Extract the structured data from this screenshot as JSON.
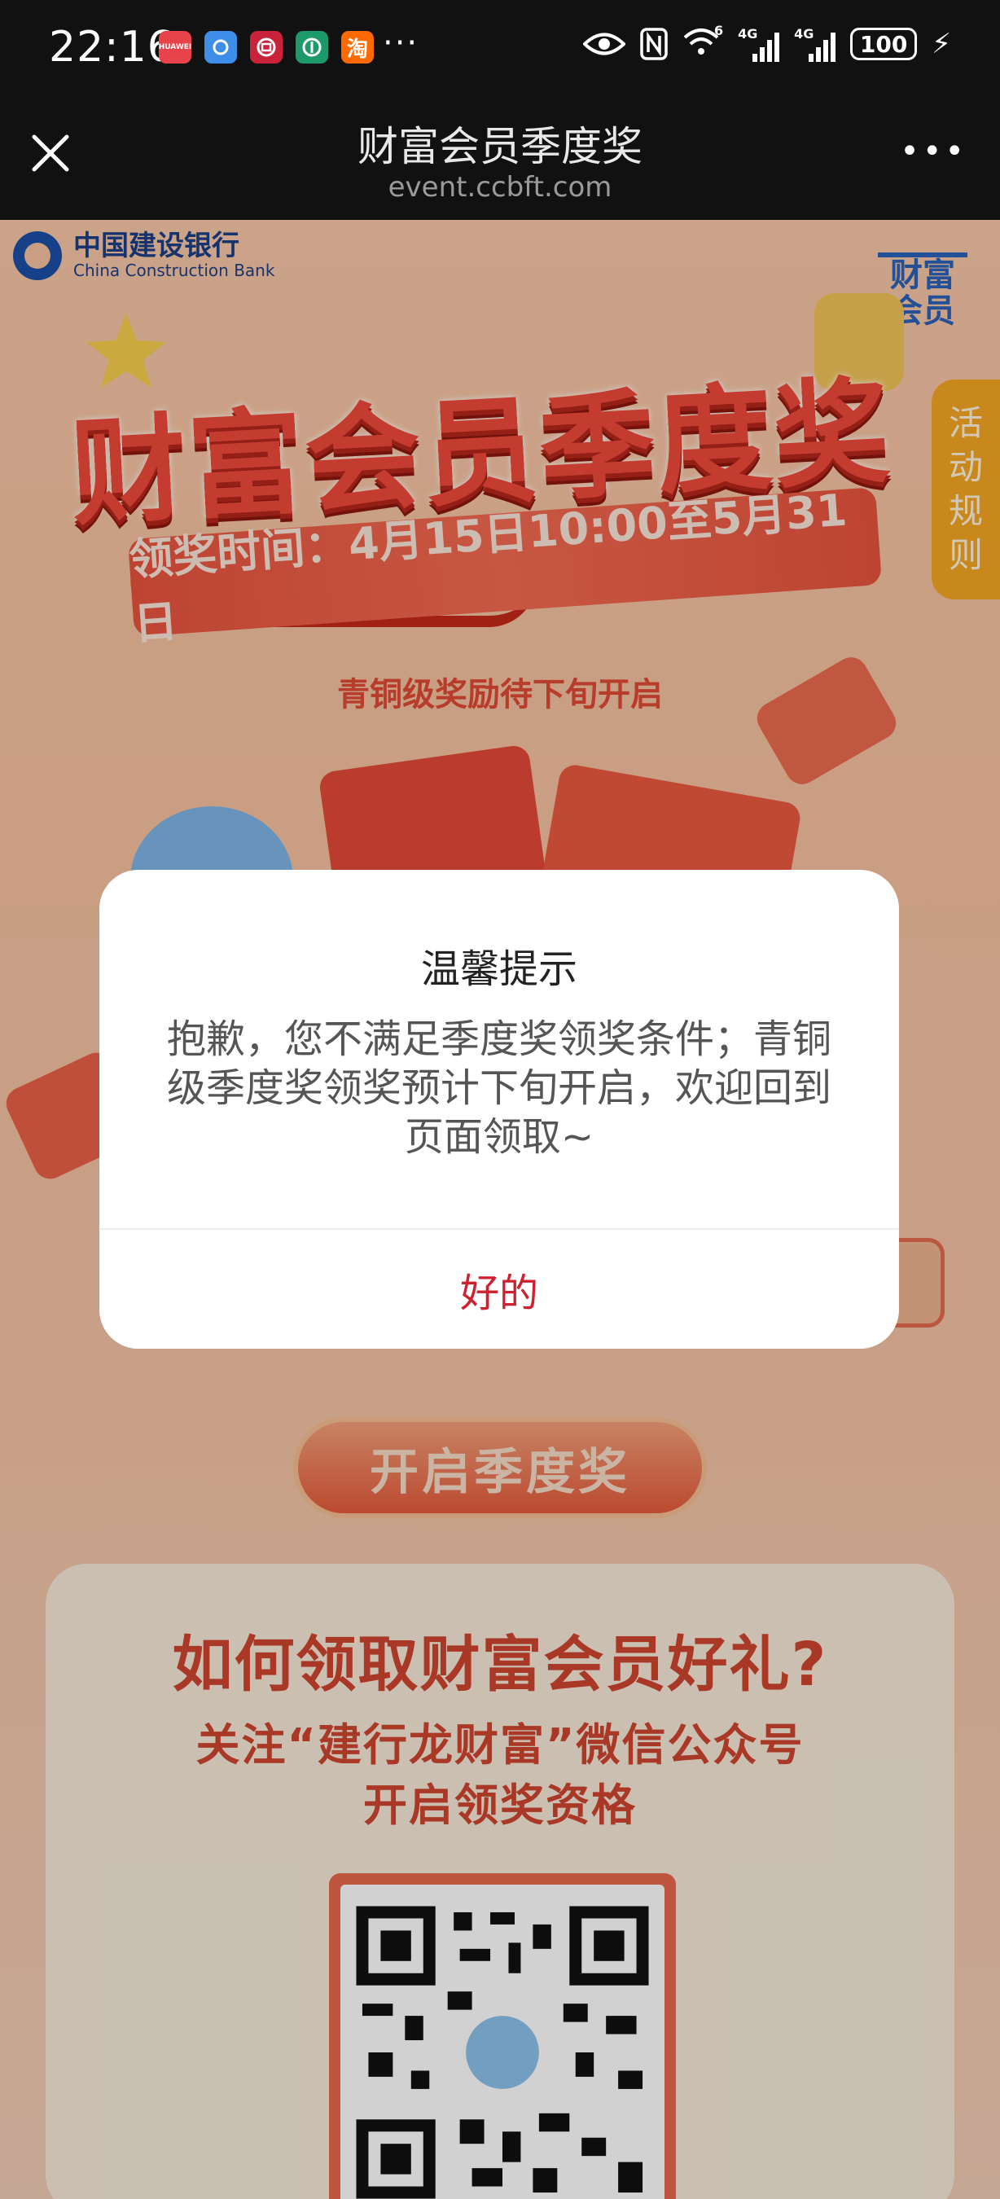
{
  "status_bar": {
    "time": "22:16",
    "app_icons": [
      "HUAWEI",
      "",
      "",
      "",
      "淘"
    ],
    "more": "···",
    "net1": "6",
    "net2": "4G",
    "net3": "4G",
    "battery": "100"
  },
  "nav": {
    "title": "财富会员季度奖",
    "url": "event.ccbft.com",
    "more": "•••"
  },
  "page": {
    "bank_name_cn": "中国建设银行",
    "bank_name_en": "China Construction Bank",
    "corner_badge": "财富会员",
    "rules_tab": "活动规则",
    "hero_title": "财富会员季度奖",
    "claim_time": "领奖时间：4月15日10:00至5月31日",
    "hint": "青铜级奖励待下旬开启",
    "open_button": "开启季度奖",
    "info_title": "如何领取财富会员好礼?",
    "info_sub_line1": "关注“建行龙财富”微信公众号",
    "info_sub_line2": "开启领奖资格"
  },
  "dialog": {
    "title": "温馨提示",
    "message": "抱歉，您不满足季度奖领奖条件；青铜级季度奖领奖预计下旬开启，欢迎回到页面领取~",
    "ok_label": "好的"
  },
  "colors": {
    "accent": "#d01f2e",
    "page_bg": "#f6c19f",
    "title_red": "#f04a3a",
    "bank_blue": "#1c4fa6"
  }
}
